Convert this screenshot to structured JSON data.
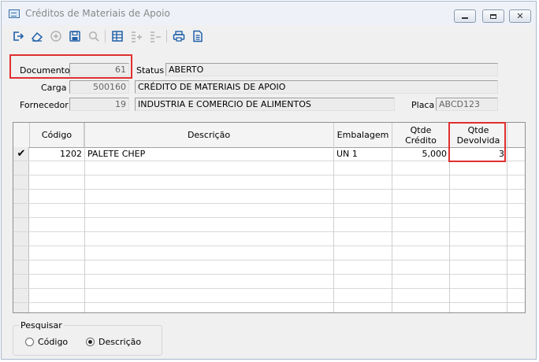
{
  "window": {
    "title": "Créditos de Materiais de Apoio",
    "controls": [
      "minimize-icon",
      "maximize-icon",
      "close-icon"
    ]
  },
  "toolbar": {
    "buttons": [
      {
        "icon": "exit-icon",
        "enabled": true
      },
      {
        "icon": "eraser-icon",
        "enabled": true
      },
      {
        "icon": "add-icon",
        "enabled": false
      },
      {
        "icon": "save-icon",
        "enabled": true
      },
      {
        "icon": "search-icon",
        "enabled": false
      },
      {
        "icon": "table-icon",
        "enabled": true
      },
      {
        "icon": "add-line-icon",
        "enabled": false
      },
      {
        "icon": "remove-line-icon",
        "enabled": false
      },
      {
        "icon": "print-icon",
        "enabled": true
      },
      {
        "icon": "document-icon",
        "enabled": true
      }
    ]
  },
  "form": {
    "documento_label": "Documento",
    "documento_value": "61",
    "status_label": "Status",
    "status_value": "ABERTO",
    "carga_label": "Carga",
    "carga_value": "500160",
    "carga_desc": "CRÉDITO DE MATERIAIS DE APOIO",
    "fornecedor_label": "Fornecedor",
    "fornecedor_value": "19",
    "fornecedor_desc": "INDUSTRIA E COMERCIO DE ALIMENTOS",
    "placa_label": "Placa",
    "placa_value": "ABCD123"
  },
  "grid": {
    "headers": {
      "codigo": "Código",
      "descricao": "Descrição",
      "embalagem": "Embalagem",
      "qtde_credito": "Qtde\nCrédito",
      "qtde_devolvida": "Qtde\nDevolvida"
    },
    "rows": [
      {
        "check": "✔",
        "codigo": "1202",
        "descricao": "PALETE CHEP",
        "embalagem": "UN 1",
        "qtde_credito": "5,000",
        "qtde_devolvida": "3"
      }
    ]
  },
  "search": {
    "group_label": "Pesquisar",
    "options": [
      {
        "label": "Código",
        "selected": false
      },
      {
        "label": "Descrição",
        "selected": true
      }
    ]
  },
  "colors": {
    "highlight": "#e03030",
    "field_bg": "#ececec",
    "window_bg": "#f0f0f0",
    "icon_blue": "#1f5fa8"
  }
}
